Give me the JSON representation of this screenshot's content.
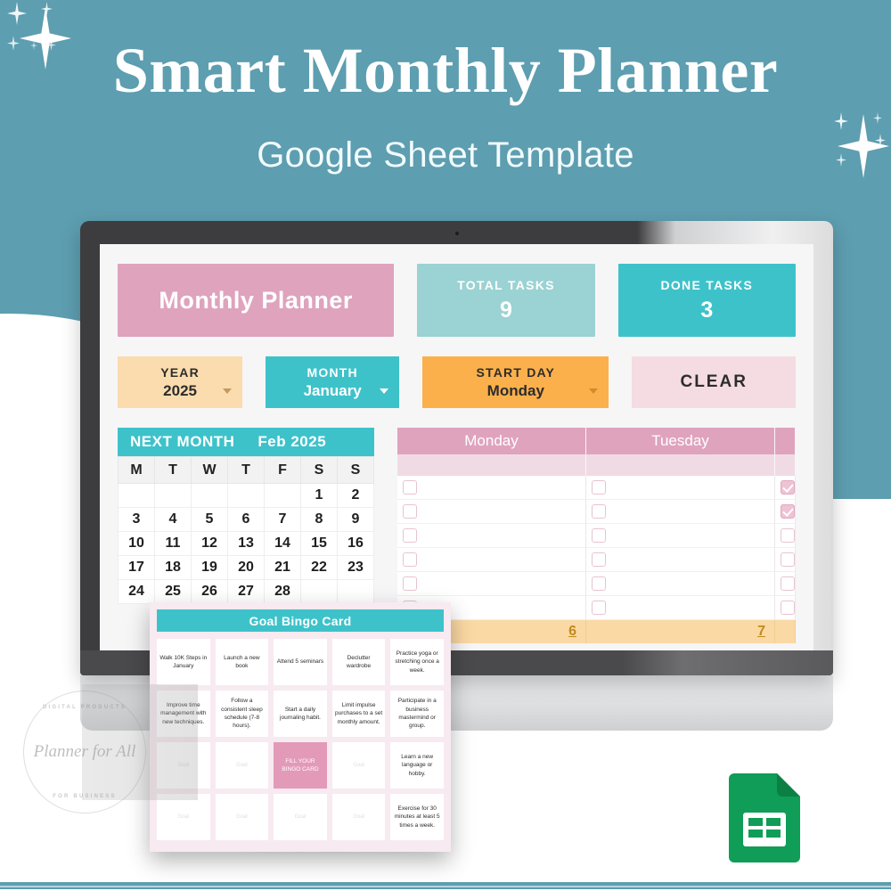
{
  "header": {
    "title": "Smart Monthly Planner",
    "subtitle": "Google Sheet Template"
  },
  "colors": {
    "background_teal": "#5d9eb0",
    "accent_pink": "#dfa3bd",
    "accent_teal": "#3ec2ca",
    "accent_teal_light": "#9bd2d3",
    "accent_orange": "#fbb04c",
    "accent_peach": "#fbdcae",
    "accent_pink_light": "#f5dbe2",
    "sheets_green": "#0f9d58"
  },
  "planner": {
    "title_card": "Monthly Planner",
    "stats": [
      {
        "label": "TOTAL TASKS",
        "value": "9",
        "style": "total"
      },
      {
        "label": "DONE TASKS",
        "value": "3",
        "style": "done"
      }
    ],
    "controls": [
      {
        "label": "YEAR",
        "value": "2025",
        "style": "year",
        "dropdown": true
      },
      {
        "label": "MONTH",
        "value": "January",
        "style": "month",
        "dropdown": true
      },
      {
        "label": "START DAY",
        "value": "Monday",
        "style": "start",
        "dropdown": true
      },
      {
        "label": "CLEAR",
        "value": "",
        "style": "clear",
        "dropdown": false
      }
    ],
    "mini_calendar": {
      "title": "NEXT MONTH",
      "month_label": "Feb  2025",
      "weekday_headers": [
        "M",
        "T",
        "W",
        "T",
        "F",
        "S",
        "S"
      ],
      "weeks": [
        [
          "",
          "",
          "",
          "",
          "",
          "1",
          "2"
        ],
        [
          "3",
          "4",
          "5",
          "6",
          "7",
          "8",
          "9"
        ],
        [
          "10",
          "11",
          "12",
          "13",
          "14",
          "15",
          "16"
        ],
        [
          "17",
          "18",
          "19",
          "20",
          "21",
          "22",
          "23"
        ],
        [
          "24",
          "25",
          "26",
          "27",
          "28",
          "",
          ""
        ]
      ]
    },
    "week_grid": {
      "day_headers": [
        "Monday",
        "Tuesday",
        ""
      ],
      "row_count": 6,
      "checked_column3_rows": [
        1,
        2
      ],
      "footer_numbers": [
        "6",
        "7",
        ""
      ]
    }
  },
  "bingo": {
    "title": "Goal Bingo Card",
    "placeholder": "Goal",
    "free_cell": "FILL YOUR BINGO CARD",
    "cells": [
      "Walk 10K Steps in January",
      "Launch a new book",
      "Attend 5 seminars",
      "Declutter wardrobe",
      "Practice yoga or stretching once a week.",
      "Improve time management with new techniques.",
      "Follow a consistent sleep schedule (7-8 hours).",
      "Start a daily journaling habit.",
      "Limit impulse purchases to a set monthly amount.",
      "Participate in a business mastermind or group.",
      "Goal",
      "Goal",
      "FILL YOUR BINGO CARD",
      "Goal",
      "Learn a new language or hobby.",
      "Goal",
      "Goal",
      "Goal",
      "Goal",
      "Exercise for 30 minutes at least 5 times a week."
    ]
  },
  "watermark": {
    "brand": "Planner for All",
    "top_arc": "DIGITAL PRODUCTS",
    "bottom_arc": "FOR BUSINESS"
  },
  "icons": {
    "sheets": "google-sheets-icon",
    "webcam": "webcam-dot",
    "sparkle": "sparkle-icon"
  }
}
